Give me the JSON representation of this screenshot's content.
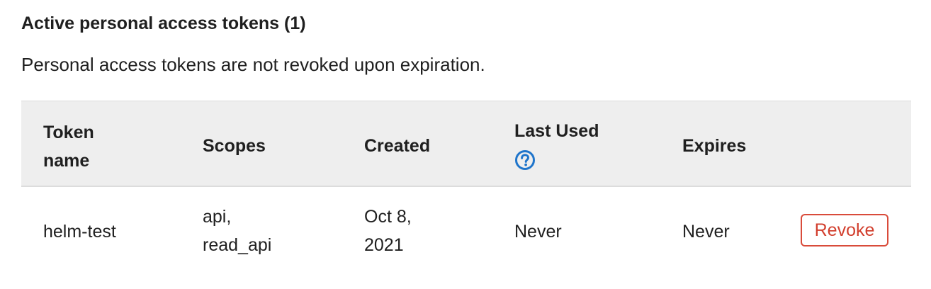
{
  "section": {
    "title": "Active personal access tokens (1)",
    "subtitle": "Personal access tokens are not revoked upon expiration."
  },
  "table": {
    "headers": {
      "token_name": [
        "Token",
        "name"
      ],
      "scopes": "Scopes",
      "created": "Created",
      "last_used": "Last Used",
      "expires": "Expires"
    },
    "help_icon": "question-circle-icon",
    "rows": [
      {
        "token_name": "helm-test",
        "scopes": [
          "api,",
          "read_api"
        ],
        "created": [
          "Oct 8,",
          "2021"
        ],
        "last_used": "Never",
        "expires": "Never",
        "action_label": "Revoke"
      }
    ]
  },
  "colors": {
    "header_bg": "#eeeeee",
    "revoke": "#d23f2e",
    "help_icon": "#1f75cb"
  }
}
